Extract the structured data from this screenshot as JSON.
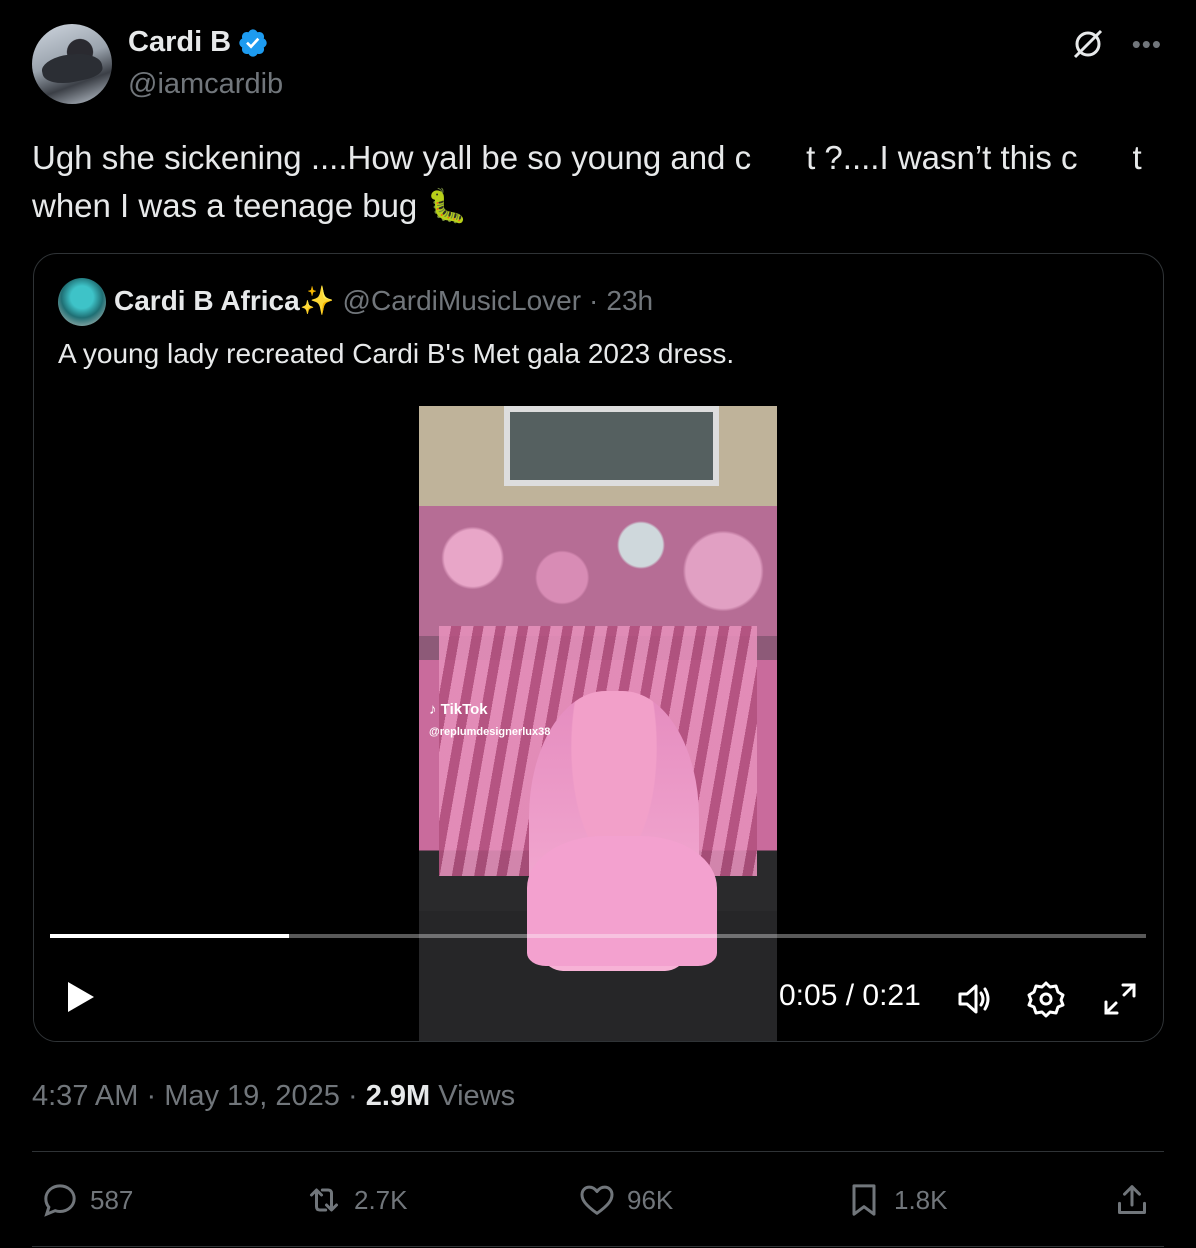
{
  "author": {
    "name": "Cardi B",
    "handle": "@iamcardib",
    "verified_color": "#1d9bf0"
  },
  "tweet": {
    "text_line1": "Ugh she sickening ....How yall be so young and c      t ?....I wasn’t this c      t",
    "text_line2": "when I was a teenage bug 🐛"
  },
  "quote": {
    "name": "Cardi B Africa✨",
    "handle": "@CardiMusicLover",
    "time": "23h",
    "text": "A young lady recreated Cardi B's Met gala 2023 dress.",
    "video": {
      "watermark": "TikTok",
      "watermark_handle": "@replumdesignerlux38",
      "time": "0:05 / 0:21",
      "progress": 0.218
    }
  },
  "meta": {
    "time": "4:37 AM",
    "date": "May 19, 2025",
    "views_count": "2.9M",
    "views_label": "Views"
  },
  "actions": {
    "replies": "587",
    "reposts": "2.7K",
    "likes": "96K",
    "bookmarks": "1.8K"
  }
}
